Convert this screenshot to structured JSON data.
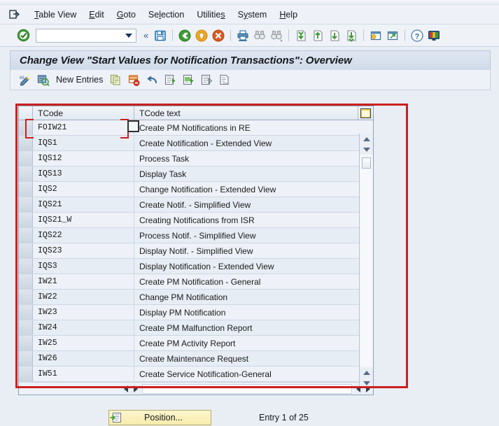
{
  "menu": {
    "system_icon": "window-menu-icon",
    "items": [
      {
        "label": "Table View",
        "accesskey_index": 0
      },
      {
        "label": "Edit",
        "accesskey_index": 0
      },
      {
        "label": "Goto",
        "accesskey_index": 0
      },
      {
        "label": "Selection",
        "accesskey_index": 2
      },
      {
        "label": "Utilities",
        "accesskey_index": 8
      },
      {
        "label": "System",
        "accesskey_index": 1
      },
      {
        "label": "Help",
        "accesskey_index": 0
      }
    ]
  },
  "toolbar": {
    "enter_icon": "green-check-enter-icon",
    "command_field_value": "",
    "command_field_placeholder": "",
    "dropdown_icon": "chevron-down-icon",
    "collapse_icon": "double-chevron-left-icon",
    "icons": [
      "save-icon",
      "back-green-icon",
      "exit-yellow-icon",
      "cancel-red-icon",
      "print-icon",
      "find-icon",
      "find-next-icon",
      "first-page-icon",
      "previous-page-icon",
      "next-page-icon",
      "last-page-icon",
      "create-session-icon",
      "create-shortcut-icon",
      "help-icon",
      "customize-local-layout-icon"
    ]
  },
  "screen": {
    "title": "Change View \"Start Values for Notification Transactions\": Overview",
    "app_toolbar": {
      "icons_left": [
        "display-change-icon",
        "check-entries-icon"
      ],
      "new_entries_label": "New Entries",
      "icons_right": [
        "copy-icon",
        "delete-icon",
        "undo-icon",
        "select-all-icon",
        "select-block-icon",
        "deselect-all-icon",
        "variable-list-icon"
      ]
    }
  },
  "grid": {
    "columns": [
      "TCode",
      "TCode text"
    ],
    "config_icon": "table-settings-icon",
    "rows": [
      {
        "tcode": "FOIW21",
        "text": "Create PM Notifications in RE"
      },
      {
        "tcode": "IQS1",
        "text": "Create Notification - Extended View"
      },
      {
        "tcode": "IQS12",
        "text": "Process Task"
      },
      {
        "tcode": "IQS13",
        "text": "Display Task"
      },
      {
        "tcode": "IQS2",
        "text": "Change Notification - Extended View"
      },
      {
        "tcode": "IQS21",
        "text": "Create Notif. - Simplified View"
      },
      {
        "tcode": "IQS21_W",
        "text": "Creating Notifications from ISR"
      },
      {
        "tcode": "IQS22",
        "text": "Process Notif. - Simplified View"
      },
      {
        "tcode": "IQS23",
        "text": "Display Notif. - Simplified View"
      },
      {
        "tcode": "IQS3",
        "text": "Display Notification - Extended View"
      },
      {
        "tcode": "IW21",
        "text": "Create PM Notification - General"
      },
      {
        "tcode": "IW22",
        "text": "Change PM Notification"
      },
      {
        "tcode": "IW23",
        "text": "Display PM Notification"
      },
      {
        "tcode": "IW24",
        "text": "Create PM Malfunction Report"
      },
      {
        "tcode": "IW25",
        "text": "Create PM Activity Report"
      },
      {
        "tcode": "IW26",
        "text": "Create Maintenance Request"
      },
      {
        "tcode": "IW51",
        "text": "Create Service Notification-General"
      }
    ],
    "vscroll": {
      "up_icon": "arrow-up-icon",
      "down_icon": "arrow-down-icon"
    },
    "hscroll": {
      "left_icon": "arrow-left-icon",
      "right_icon": "arrow-right-icon"
    }
  },
  "footer": {
    "position_button_label": "Position...",
    "position_button_icon": "position-icon",
    "entry_status": "Entry 1 of 25"
  },
  "colors": {
    "annotation": "#cc1f1f",
    "page_background": "#e9eef5",
    "row_even": "#e7edf5",
    "row_odd": "#eef2f8",
    "position_button": "#f8ecab"
  }
}
